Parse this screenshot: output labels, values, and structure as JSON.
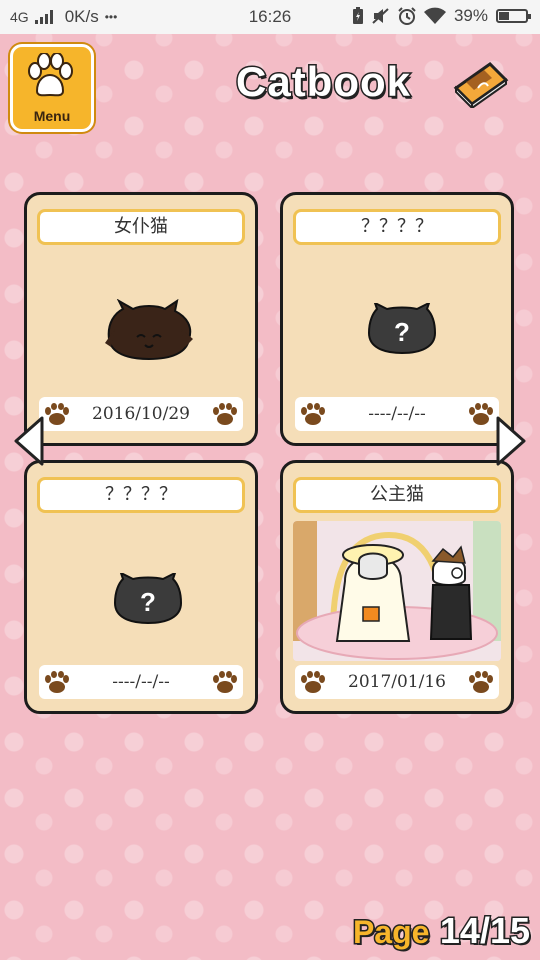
{
  "status_bar": {
    "network": "4G",
    "speed": "0K/s",
    "dots": "•••",
    "time": "16:26",
    "battery": "39%",
    "battery_level": 0.39
  },
  "menu": {
    "label": "Menu",
    "icon": "paw-icon"
  },
  "title": "Catbook",
  "cards": [
    {
      "name": "女仆猫",
      "date": "2016/10/29",
      "state": "seen"
    },
    {
      "name": "？？？？",
      "date": "----/--/--",
      "state": "unknown"
    },
    {
      "name": "？？？？",
      "date": "----/--/--",
      "state": "unknown"
    },
    {
      "name": "公主猫",
      "date": "2017/01/16",
      "state": "photo"
    }
  ],
  "page": {
    "word": "Page",
    "current": "14",
    "total": "15"
  },
  "colors": {
    "background": "#f3bcc6",
    "card": "#f5deb8",
    "accent": "#f6b52b",
    "border": "#1c1c1c"
  }
}
